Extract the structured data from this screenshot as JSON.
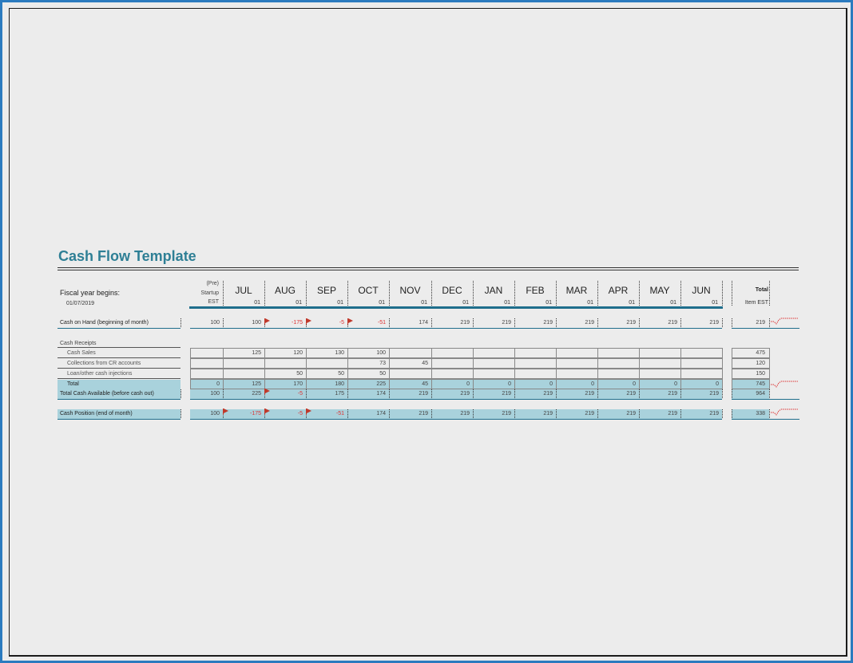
{
  "title": "Cash Flow Template",
  "fiscal": {
    "label": "Fiscal year begins:",
    "date": "01/07/2019"
  },
  "header": {
    "prestart": [
      "(Pre)",
      "Startup",
      "EST"
    ],
    "months": [
      "JUL",
      "AUG",
      "SEP",
      "OCT",
      "NOV",
      "DEC",
      "JAN",
      "FEB",
      "MAR",
      "APR",
      "MAY",
      "JUN"
    ],
    "day": "01",
    "total": [
      "Total",
      "Item EST"
    ]
  },
  "rows": {
    "cash_on_hand": {
      "label": "Cash on Hand (beginning of month)",
      "values": [
        "100",
        "100",
        "-175",
        "-5",
        "-51",
        "174",
        "219",
        "219",
        "219",
        "219",
        "219",
        "219",
        "219"
      ],
      "total": "219"
    },
    "receipts_heading": "Cash Receipts",
    "cash_sales": {
      "label": "Cash Sales",
      "values": [
        "",
        "125",
        "120",
        "130",
        "100",
        "",
        "",
        "",
        "",
        "",
        "",
        "",
        ""
      ],
      "total": "475"
    },
    "collections": {
      "label": "Collections from CR accounts",
      "values": [
        "",
        "",
        "",
        "",
        "73",
        "45",
        "",
        "",
        "",
        "",
        "",
        "",
        ""
      ],
      "total": "120"
    },
    "loan": {
      "label": "Loan/other cash injections",
      "values": [
        "",
        "",
        "50",
        "50",
        "50",
        "",
        "",
        "",
        "",
        "",
        "",
        "",
        ""
      ],
      "total": "150"
    },
    "total": {
      "label": "Total",
      "values": [
        "0",
        "125",
        "170",
        "180",
        "225",
        "45",
        "0",
        "0",
        "0",
        "0",
        "0",
        "0",
        "0"
      ],
      "total": "745"
    },
    "total_available": {
      "label": "Total Cash Available (before cash out)",
      "values": [
        "100",
        "225",
        "-5",
        "175",
        "174",
        "219",
        "219",
        "219",
        "219",
        "219",
        "219",
        "219",
        "219"
      ],
      "total": "964"
    },
    "cash_position": {
      "label": "Cash Position (end of month)",
      "values": [
        "100",
        "-175",
        "-5",
        "-51",
        "174",
        "219",
        "219",
        "219",
        "219",
        "219",
        "219",
        "219",
        "219"
      ],
      "total": "338"
    }
  },
  "colors": {
    "accent": "#2e7f95",
    "band": "#a9d2dc",
    "negative": "#dd3333",
    "flag": "#c0392b"
  }
}
